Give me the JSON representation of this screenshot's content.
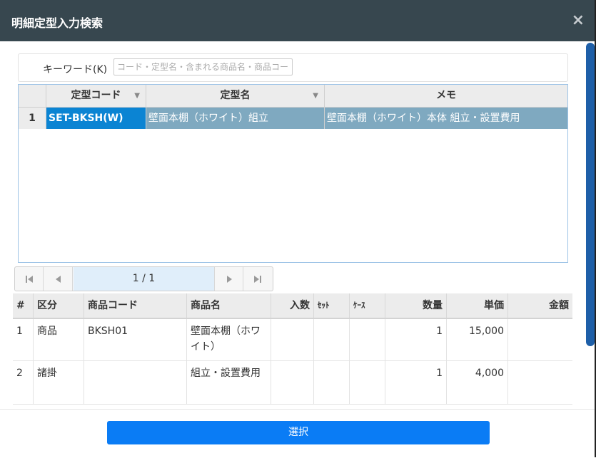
{
  "dialog": {
    "title": "明細定型入力検索",
    "close_label": "×"
  },
  "search": {
    "label": "キーワード(K)",
    "placeholder": "コード・定型名・含まれる商品名・商品コード"
  },
  "template_grid": {
    "columns": [
      "定型コード",
      "定型名",
      "メモ"
    ],
    "rows": [
      {
        "num": "1",
        "code": "SET-BKSH(W)",
        "name": "壁面本棚（ホワイト）組立",
        "memo": "壁面本棚（ホワイト）本体 組立・設置費用"
      }
    ]
  },
  "pager": {
    "info": "1 / 1",
    "first_icon": "first-page-icon",
    "prev_icon": "prev-page-icon",
    "next_icon": "next-page-icon",
    "last_icon": "last-page-icon"
  },
  "detail_grid": {
    "columns": [
      "#",
      "区分",
      "商品コード",
      "商品名",
      "入数",
      "ｾｯﾄ",
      "ｹｰｽ",
      "数量",
      "単価",
      "金額"
    ],
    "rows": [
      {
        "num": "1",
        "kubun": "商品",
        "code": "BKSH01",
        "name": "壁面本棚（ホワイト）",
        "irisu": "",
        "set": "",
        "case": "",
        "qty": "1",
        "price": "15,000",
        "amount": ""
      },
      {
        "num": "2",
        "kubun": "諸掛",
        "code": "",
        "name": "組立・設置費用",
        "irisu": "",
        "set": "",
        "case": "",
        "qty": "1",
        "price": "4,000",
        "amount": ""
      }
    ]
  },
  "footer": {
    "select_label": "選択"
  },
  "colors": {
    "titlebar": "#37474f",
    "selected_cell": "#0b84d3",
    "selected_row": "#7fa9c0",
    "primary_button": "#0a7cf5",
    "scroll_thumb": "#1e5fa8"
  }
}
